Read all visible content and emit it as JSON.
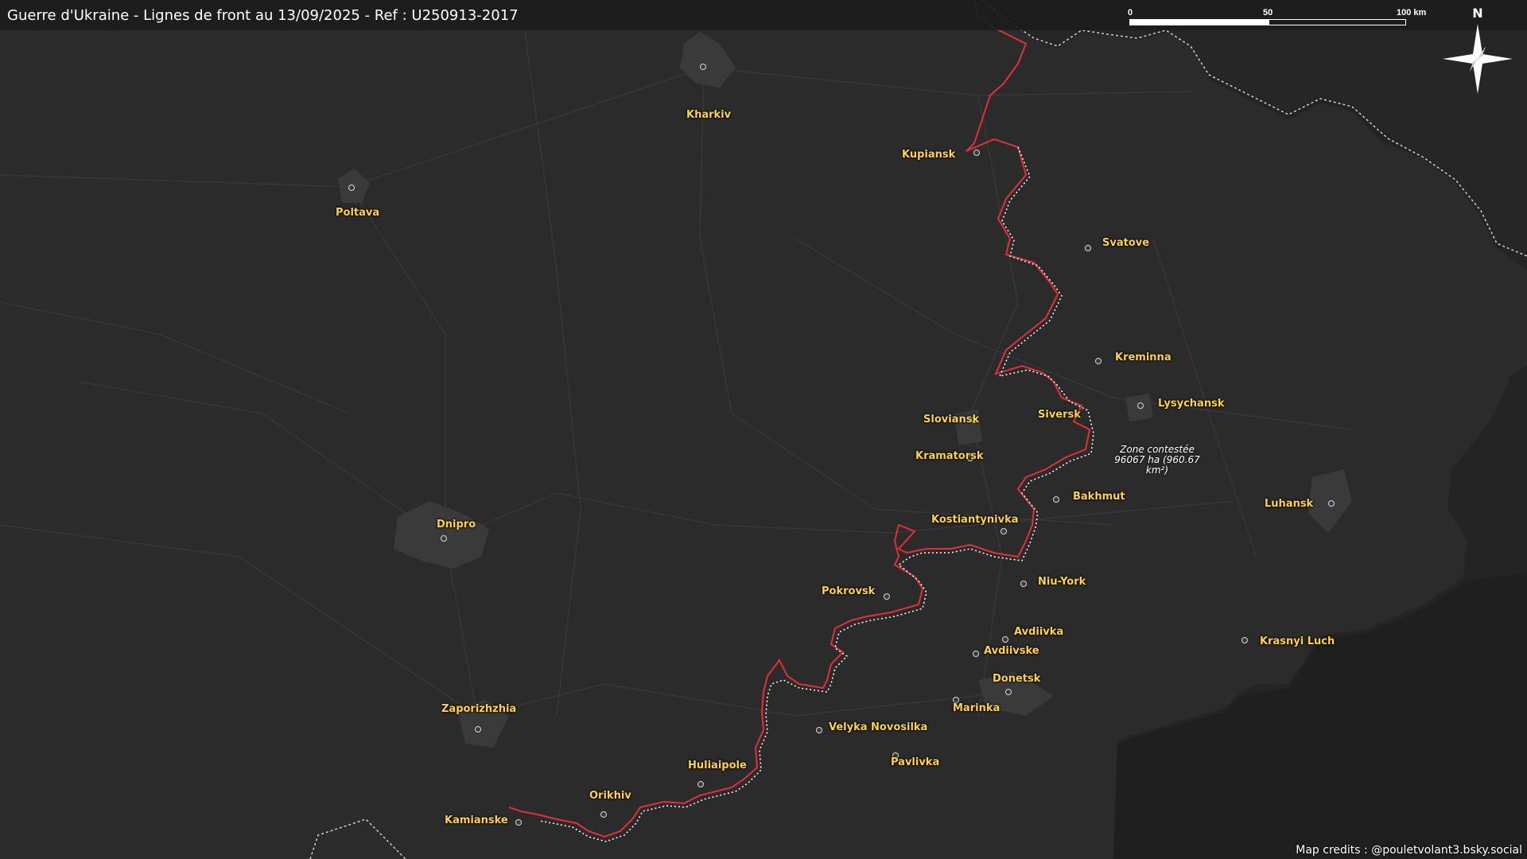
{
  "title": "Guerre d'Ukraine - Lignes de front au 13/09/2025 - Ref : U250913-2017",
  "credits": "Map credits : @pouletvolant3.bsky.social",
  "scale": {
    "ticks": [
      "0",
      "50",
      "100 km"
    ]
  },
  "north_label": "N",
  "zone": {
    "line1": "Zone contestée",
    "line2": "96067 ha (960.67 km²)"
  },
  "colors": {
    "background": "#2b2b2b",
    "occupied": "#242424",
    "front_line": "#e0303a",
    "city_label": "#ffd24a",
    "border": "#d0d0d0"
  },
  "cities": [
    {
      "name": "Kharkiv"
    },
    {
      "name": "Kupiansk"
    },
    {
      "name": "Poltava"
    },
    {
      "name": "Svatove"
    },
    {
      "name": "Kreminna"
    },
    {
      "name": "Lysychansk"
    },
    {
      "name": "Sloviansk"
    },
    {
      "name": "Siversk"
    },
    {
      "name": "Kramatorsk"
    },
    {
      "name": "Bakhmut"
    },
    {
      "name": "Luhansk"
    },
    {
      "name": "Dnipro"
    },
    {
      "name": "Kostiantynivka"
    },
    {
      "name": "Niu-York"
    },
    {
      "name": "Pokrovsk"
    },
    {
      "name": "Avdiivka"
    },
    {
      "name": "Avdiivske"
    },
    {
      "name": "Krasnyi Luch"
    },
    {
      "name": "Donetsk"
    },
    {
      "name": "Zaporizhzhia"
    },
    {
      "name": "Marinka"
    },
    {
      "name": "Velyka Novosilka"
    },
    {
      "name": "Pavlivka"
    },
    {
      "name": "Huliaipole"
    },
    {
      "name": "Orikhiv"
    },
    {
      "name": "Kamianske"
    }
  ]
}
